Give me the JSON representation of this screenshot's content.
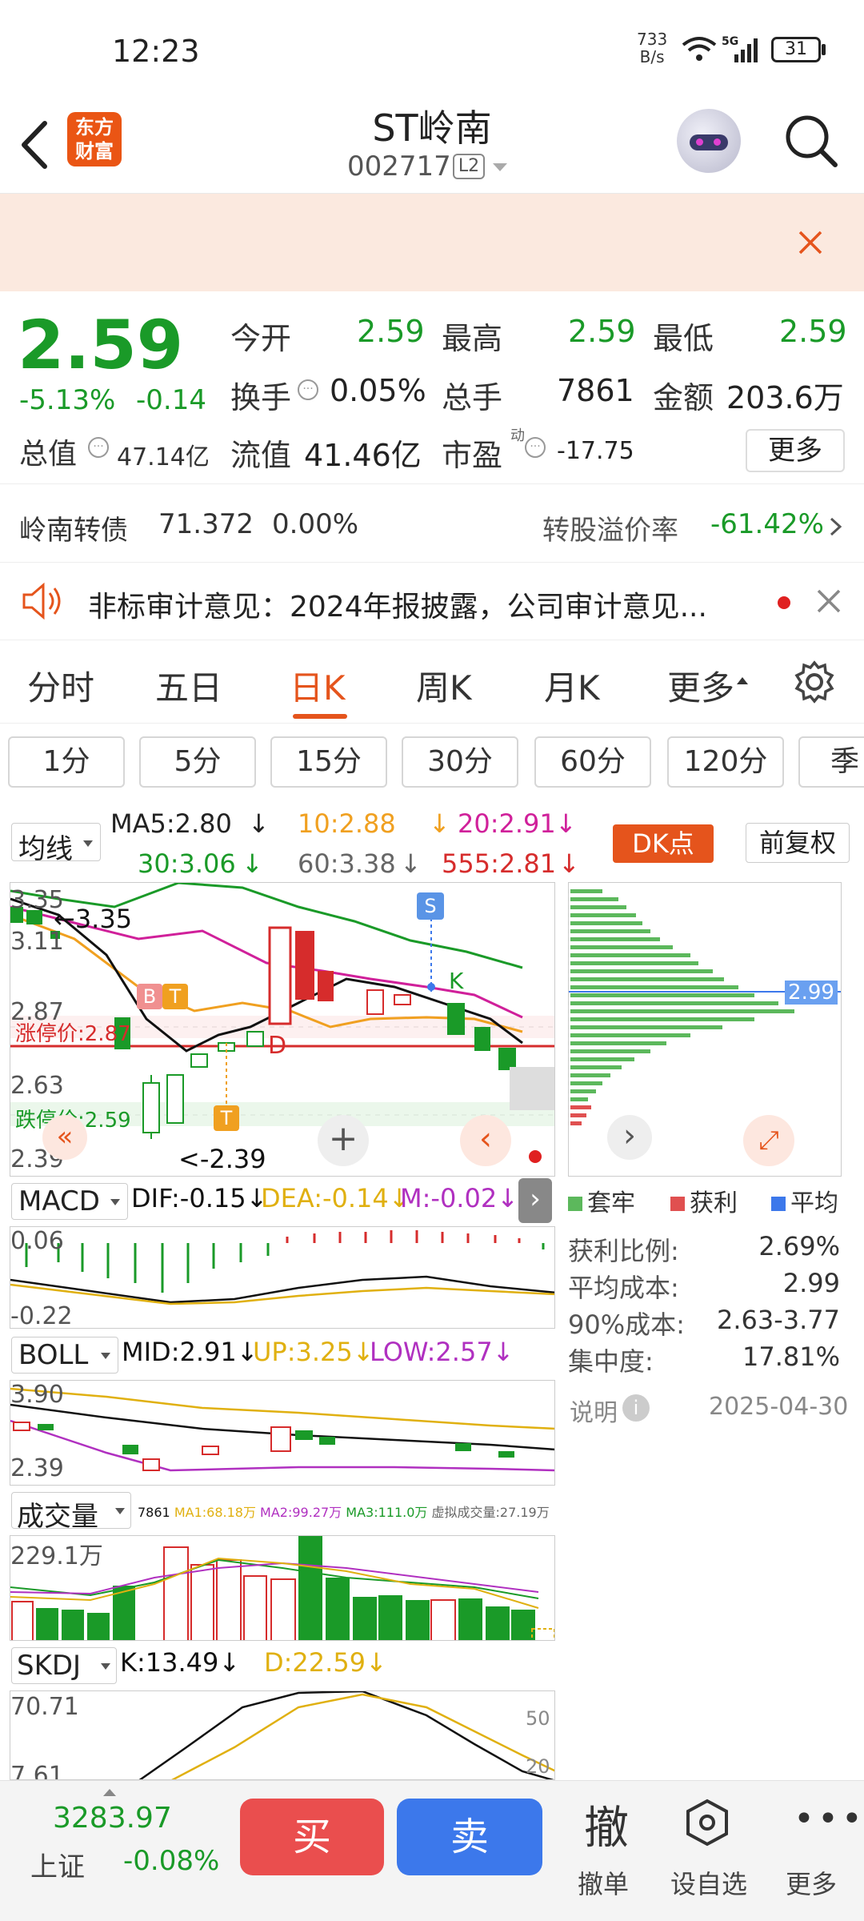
{
  "status_bar": {
    "time": "12:23",
    "net_speed_value": "733",
    "net_speed_unit": "B/s",
    "battery": "31",
    "network": "5G"
  },
  "header": {
    "logo_text": "东方财富",
    "stock_name": "ST岭南",
    "stock_code": "002717",
    "level_badge": "L2"
  },
  "quote": {
    "price": "2.59",
    "change_pct": "-5.13%",
    "change": "-0.14",
    "open_label": "今开",
    "open": "2.59",
    "high_label": "最高",
    "high": "2.59",
    "low_label": "最低",
    "low": "2.59",
    "turnover_label": "换手",
    "turnover": "0.05%",
    "volume_label": "总手",
    "volume": "7861",
    "amount_label": "金额",
    "amount": "203.6万",
    "mcap_label": "总值",
    "mcap": "47.14亿",
    "float_label": "流值",
    "float": "41.46亿",
    "pe_label": "市盈",
    "pe_sup": "动",
    "pe": "-17.75",
    "more_button": "更多"
  },
  "bond": {
    "name": "岭南转债",
    "price": "71.372",
    "change": "0.00%",
    "premium_label": "转股溢价率",
    "premium": "-61.42%"
  },
  "notice": {
    "text": "非标审计意见：2024年报披露，公司审计意见..."
  },
  "tabs": [
    "分时",
    "五日",
    "日K",
    "周K",
    "月K",
    "更多"
  ],
  "periods": [
    "1分",
    "5分",
    "15分",
    "30分",
    "60分",
    "120分",
    "季"
  ],
  "ma": {
    "select": "均线",
    "ma5": "MA5:2.80",
    "ma10": "10:2.88",
    "ma20": "20:2.91",
    "ma30": "30:3.06",
    "ma60": "60:3.38",
    "ma555": "555:2.81",
    "dk_button": "DK点",
    "adjust_button": "前复权"
  },
  "kchart": {
    "y_labels": [
      "3.35",
      "3.11",
      "2.87",
      "2.63",
      "2.39"
    ],
    "high_marker": "3.35",
    "low_marker": "<-2.39",
    "limit_up": "涨停价:2.87",
    "limit_down": "跌停价:2.59",
    "marker_b": "B",
    "marker_t": "T",
    "marker_s": "S",
    "marker_k": "K",
    "marker_d": "D"
  },
  "chip": {
    "price_tag": "2.99",
    "legend": [
      "套牢",
      "获利",
      "平均"
    ],
    "rows": [
      {
        "label": "获利比例:",
        "value": "2.69%"
      },
      {
        "label": "平均成本:",
        "value": "2.99"
      },
      {
        "label": "90%成本:",
        "value": "2.63-3.77"
      },
      {
        "label": "集中度:",
        "value": "17.81%"
      }
    ],
    "note_label": "说明",
    "date": "2025-04-30"
  },
  "macd": {
    "select": "MACD",
    "dif": "DIF:-0.15",
    "dea": "DEA:-0.14",
    "m": "M:-0.02",
    "y_top": "0.06",
    "y_bottom": "-0.22"
  },
  "boll": {
    "select": "BOLL",
    "mid": "MID:2.91",
    "up": "UP:3.25",
    "low": "LOW:2.57",
    "y_top": "3.90",
    "y_bottom": "2.39"
  },
  "volume": {
    "select": "成交量",
    "v": "7861",
    "ma1": "MA1:68.18万",
    "ma2": "MA2:99.27万",
    "ma3": "MA3:111.0万",
    "virtual": "虚拟成交量:27.19万",
    "y_top": "229.1万"
  },
  "skdj": {
    "select": "SKDJ",
    "k": "K:13.49",
    "d": "D:22.59",
    "y_top": "70.71",
    "y_bottom": "7.61",
    "r50": "50",
    "r20": "20"
  },
  "bottom": {
    "index_value": "3283.97",
    "index_name": "上证",
    "index_change": "-0.08%",
    "buy": "买",
    "sell": "卖",
    "cancel_icon": "撤",
    "cancel_label": "撤单",
    "watch_label": "设自选",
    "more_label": "更多"
  },
  "colors": {
    "up": "#d62c2c",
    "down": "#1a9a28",
    "accent": "#e5541c",
    "buy": "#ea4e4e",
    "sell": "#3c78eb"
  }
}
